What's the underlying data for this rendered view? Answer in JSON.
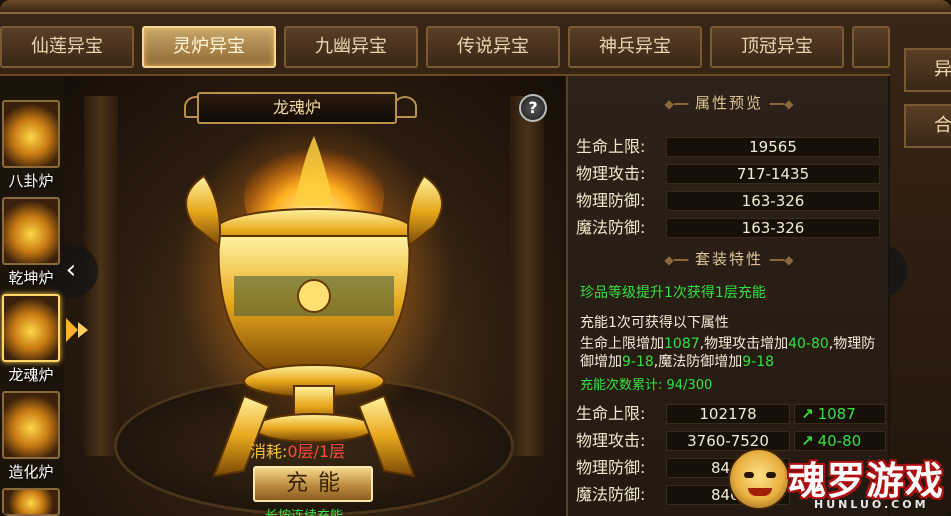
{
  "tabs": [
    "仙莲异宝",
    "灵炉异宝",
    "九幽异宝",
    "传说异宝",
    "神兵异宝",
    "顶冠异宝"
  ],
  "active_tab": 1,
  "side_tabs": [
    "异",
    "合"
  ],
  "furnaces": [
    {
      "name": "八卦炉"
    },
    {
      "name": "乾坤炉"
    },
    {
      "name": "龙魂炉"
    },
    {
      "name": "造化炉"
    }
  ],
  "active_furnace": 2,
  "scene": {
    "title": "龙魂炉",
    "help": "?",
    "prev": "‹",
    "next": "›",
    "consume_label": "消耗:",
    "consume_value": "0层/1层",
    "charge_button": "充能",
    "hold_hint": "长按连续充能"
  },
  "panel": {
    "preview_title": "属性预览",
    "base_stats": [
      {
        "label": "生命上限:",
        "value": "19565"
      },
      {
        "label": "物理攻击:",
        "value": "717-1435"
      },
      {
        "label": "物理防御:",
        "value": "163-326"
      },
      {
        "label": "魔法防御:",
        "value": "163-326"
      }
    ],
    "set_title": "套装特性",
    "set_line": "珍品等级提升1次获得1层充能",
    "charge_intro": "充能1次可获得以下属性",
    "charge_desc": {
      "p1": "生命上限增加",
      "v1": "1087",
      "p2": ",物理攻击增加",
      "v2": "40-80",
      "p3": ",物理防御增加",
      "v3": "9-18",
      "p4": ",魔法防御增加",
      "v4": "9-18"
    },
    "charge_count_label": "充能次数累计:",
    "charge_count_value": "94/300",
    "charged_stats": [
      {
        "label": "生命上限:",
        "value": "102178",
        "bonus": "1087"
      },
      {
        "label": "物理攻击:",
        "value": "3760-7520",
        "bonus": "40-80"
      },
      {
        "label": "物理防御:",
        "value": "846-",
        "bonus": ""
      },
      {
        "label": "魔法防御:",
        "value": "846-",
        "bonus": ""
      }
    ]
  },
  "watermark": {
    "title": "魂罗游戏",
    "sub": "HUNLUO.COM"
  }
}
